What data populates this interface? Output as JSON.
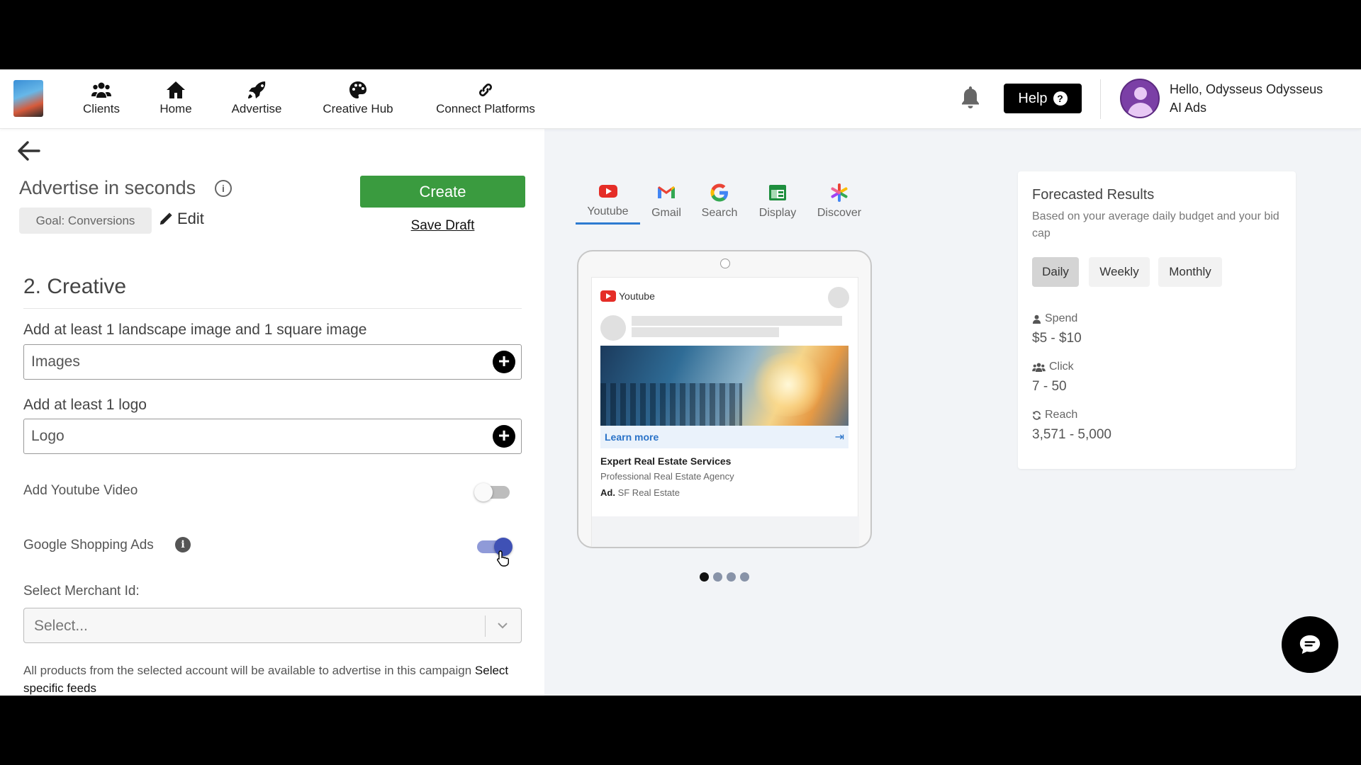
{
  "header": {
    "nav": [
      {
        "label": "Clients",
        "icon": "users-icon"
      },
      {
        "label": "Home",
        "icon": "home-icon"
      },
      {
        "label": "Advertise",
        "icon": "rocket-icon"
      },
      {
        "label": "Creative Hub",
        "icon": "palette-icon"
      },
      {
        "label": "Connect Platforms",
        "icon": "link-icon"
      }
    ],
    "help_label": "Help",
    "user_greeting": "Hello, Odysseus Odysseus",
    "user_org": "AI Ads"
  },
  "left": {
    "title": "Advertise in seconds",
    "goal_chip": "Goal: Conversions",
    "edit_label": "Edit",
    "create_label": "Create",
    "save_draft_label": "Save Draft",
    "section_title": "2. Creative",
    "images_label": "Add at least 1 landscape image and 1 square image",
    "images_placeholder": "Images",
    "logo_label": "Add at least 1 logo",
    "logo_placeholder": "Logo",
    "youtube_video_label": "Add Youtube Video",
    "youtube_video_on": false,
    "shopping_label": "Google Shopping Ads",
    "shopping_on": true,
    "merchant_label": "Select Merchant Id:",
    "merchant_placeholder": "Select...",
    "products_text": "All products from the selected account will be available to advertise in this campaign",
    "products_link": "Select specific feeds"
  },
  "preview": {
    "tabs": [
      {
        "label": "Youtube",
        "icon": "youtube-icon",
        "active": true
      },
      {
        "label": "Gmail",
        "icon": "gmail-icon",
        "active": false
      },
      {
        "label": "Search",
        "icon": "google-icon",
        "active": false
      },
      {
        "label": "Display",
        "icon": "display-icon",
        "active": false
      },
      {
        "label": "Discover",
        "icon": "discover-icon",
        "active": false
      }
    ],
    "ad": {
      "platform": "Youtube",
      "cta": "Learn more",
      "headline": "Expert Real Estate Services",
      "description": "Professional Real Estate Agency",
      "ad_prefix": "Ad.",
      "advertiser": "SF Real Estate"
    },
    "carousel_count": 4,
    "carousel_active": 0
  },
  "forecast": {
    "title": "Forecasted Results",
    "subtitle": "Based on your average daily budget and your bid cap",
    "tabs": [
      {
        "label": "Daily",
        "active": true
      },
      {
        "label": "Weekly",
        "active": false
      },
      {
        "label": "Monthly",
        "active": false
      }
    ],
    "metrics": [
      {
        "label": "Spend",
        "value": "$5 - $10",
        "icon": "user-icon"
      },
      {
        "label": "Click",
        "value": "7 - 50",
        "icon": "users-icon"
      },
      {
        "label": "Reach",
        "value": "3,571 - 5,000",
        "icon": "refresh-icon"
      }
    ]
  },
  "colors": {
    "create_button": "#3a9b3f",
    "toggle_on": "#3f51b5",
    "tab_underline": "#2e7bd1"
  }
}
